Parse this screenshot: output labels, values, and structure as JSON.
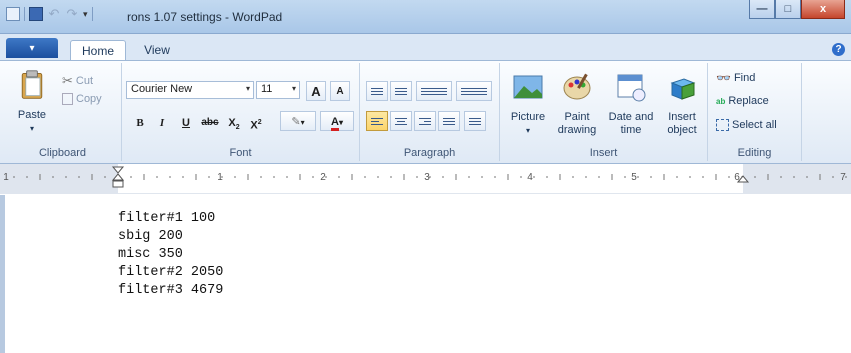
{
  "window": {
    "title": "rons 1.07 settings - WordPad",
    "buttons": {
      "minimize": "—",
      "maximize": "□",
      "close": "x"
    }
  },
  "tabs": [
    {
      "label": "Home",
      "active": true
    },
    {
      "label": "View",
      "active": false
    }
  ],
  "help_glyph": "?",
  "clipboard": {
    "paste_label": "Paste",
    "cut_label": "Cut",
    "copy_label": "Copy",
    "group_label": "Clipboard"
  },
  "font": {
    "family_value": "Courier New",
    "size_value": "11",
    "grow_glyph": "A",
    "shrink_glyph": "A",
    "bold": "B",
    "italic": "I",
    "underline": "U",
    "strike": "abc",
    "subscript": "X",
    "superscript": "X",
    "color_glyph": "A",
    "group_label": "Font"
  },
  "paragraph": {
    "group_label": "Paragraph"
  },
  "insert": {
    "picture_label": "Picture",
    "paint_label_1": "Paint",
    "paint_label_2": "drawing",
    "datetime_label_1": "Date and",
    "datetime_label_2": "time",
    "object_label_1": "Insert",
    "object_label_2": "object",
    "group_label": "Insert"
  },
  "editing": {
    "find_label": "Find",
    "replace_label": "Replace",
    "selectall_label": "Select all",
    "group_label": "Editing"
  },
  "ruler": {
    "numbers": [
      "1",
      "1",
      "2",
      "3",
      "4",
      "5",
      "6",
      "7"
    ]
  },
  "document": {
    "text": "filter#1 100\nsbig 200\nmisc 350\nfilter#2 2050\nfilter#3 4679"
  },
  "colors": {
    "accent": "#1b4f9e",
    "active_align": "#fbd46b",
    "close_button": "#c5452c"
  }
}
